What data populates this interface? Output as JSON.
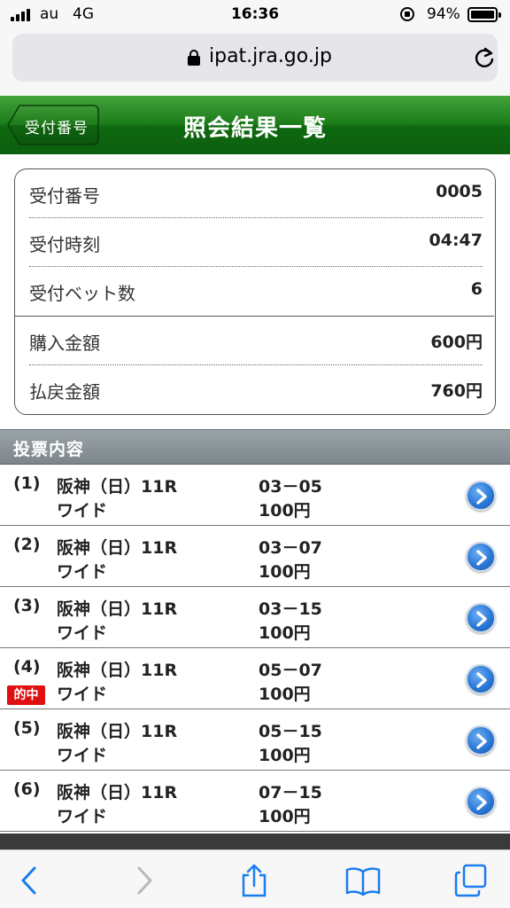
{
  "status_bar": {
    "carrier": "au",
    "network": "4G",
    "time": "16:36",
    "battery": "94%"
  },
  "browser": {
    "url": "ipat.jra.go.jp"
  },
  "header": {
    "back_label": "受付番号",
    "title": "照会結果一覧"
  },
  "summary": {
    "receipt_number": {
      "label": "受付番号",
      "value": "0005"
    },
    "receipt_time": {
      "label": "受付時刻",
      "value": "04:47"
    },
    "bet_count": {
      "label": "受付ベット数",
      "value": "6"
    },
    "purchase_amount": {
      "label": "購入金額",
      "value": "600円"
    },
    "payout_amount": {
      "label": "払戻金額",
      "value": "760円"
    }
  },
  "bets_section_title": "投票内容",
  "hit_label": "的中",
  "bets": [
    {
      "num": "(1)",
      "race": "阪神（日）11R",
      "type": "ワイド",
      "combo": "03－05",
      "amount": "100円",
      "hit": false
    },
    {
      "num": "(2)",
      "race": "阪神（日）11R",
      "type": "ワイド",
      "combo": "03－07",
      "amount": "100円",
      "hit": false
    },
    {
      "num": "(3)",
      "race": "阪神（日）11R",
      "type": "ワイド",
      "combo": "03－15",
      "amount": "100円",
      "hit": false
    },
    {
      "num": "(4)",
      "race": "阪神（日）11R",
      "type": "ワイド",
      "combo": "05－07",
      "amount": "100円",
      "hit": true
    },
    {
      "num": "(5)",
      "race": "阪神（日）11R",
      "type": "ワイド",
      "combo": "05－15",
      "amount": "100円",
      "hit": false
    },
    {
      "num": "(6)",
      "race": "阪神（日）11R",
      "type": "ワイド",
      "combo": "07－15",
      "amount": "100円",
      "hit": false
    }
  ],
  "icons": {
    "back": "chevron-left-icon",
    "forward": "chevron-right-icon",
    "share": "share-icon",
    "bookmarks": "book-icon",
    "tabs": "tabs-icon",
    "detail": "chevron-circle-right-icon"
  },
  "colors": {
    "header_green": "#1b7d1a",
    "hit_red": "#e01010",
    "detail_blue": "#2a78d6",
    "ios_blue": "#1a7cf0"
  }
}
